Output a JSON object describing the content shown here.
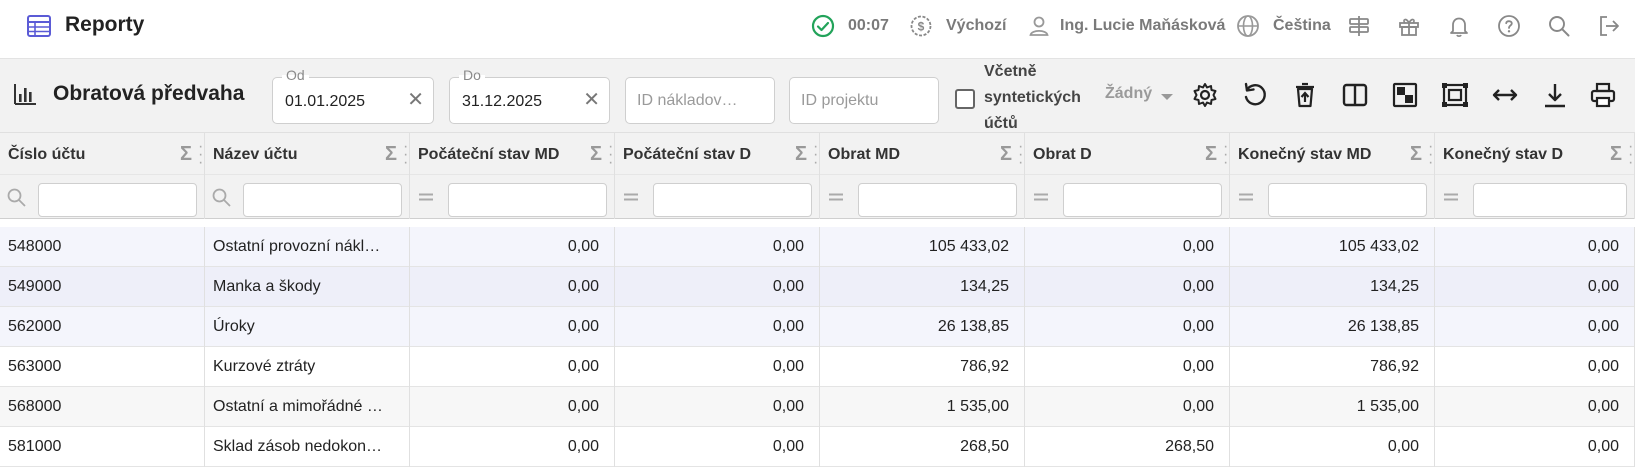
{
  "header": {
    "app_title": "Reporty",
    "timer": "00:07",
    "currency_profile": "Výchozí",
    "user_name": "Ing. Lucie Maňásková",
    "language": "Čeština",
    "colors": {
      "accent": "#5b5bd6",
      "success": "#22a35a",
      "muted": "#7a7a7a"
    }
  },
  "toolbar": {
    "report_title": "Obratová předvaha",
    "date_from": {
      "label": "Od",
      "value": "01.01.2025"
    },
    "date_to": {
      "label": "Do",
      "value": "31.12.2025"
    },
    "cost_id_placeholder": "ID nákladov…",
    "project_id_placeholder": "ID projektu",
    "include_synthetic_label": [
      "Včetně",
      "syntetických",
      "účtů"
    ],
    "include_synthetic_checked": false,
    "grouping_select_value": "Žádný",
    "icons": [
      "settings-icon",
      "reset-icon",
      "clear-filters-icon",
      "columns-icon",
      "layout-icon",
      "fit-screen-icon",
      "auto-width-icon",
      "download-icon",
      "print-icon"
    ]
  },
  "table": {
    "columns": [
      "Číslo účtu",
      "Název účtu",
      "Počáteční stav MD",
      "Počáteční stav D",
      "Obrat MD",
      "Obrat D",
      "Konečný stav MD",
      "Konečný stav D"
    ],
    "rows": [
      [
        "548000",
        "Ostatní provozní nákl…",
        "0,00",
        "0,00",
        "105 433,02",
        "0,00",
        "105 433,02",
        "0,00"
      ],
      [
        "549000",
        "Manka a škody",
        "0,00",
        "0,00",
        "134,25",
        "0,00",
        "134,25",
        "0,00"
      ],
      [
        "562000",
        "Úroky",
        "0,00",
        "0,00",
        "26 138,85",
        "0,00",
        "26 138,85",
        "0,00"
      ],
      [
        "563000",
        "Kurzové ztráty",
        "0,00",
        "0,00",
        "786,92",
        "0,00",
        "786,92",
        "0,00"
      ],
      [
        "568000",
        "Ostatní a mimořádné …",
        "0,00",
        "0,00",
        "1 535,00",
        "0,00",
        "1 535,00",
        "0,00"
      ],
      [
        "581000",
        "Sklad zásob nedokon…",
        "0,00",
        "0,00",
        "268,50",
        "268,50",
        "0,00",
        "0,00"
      ]
    ]
  }
}
